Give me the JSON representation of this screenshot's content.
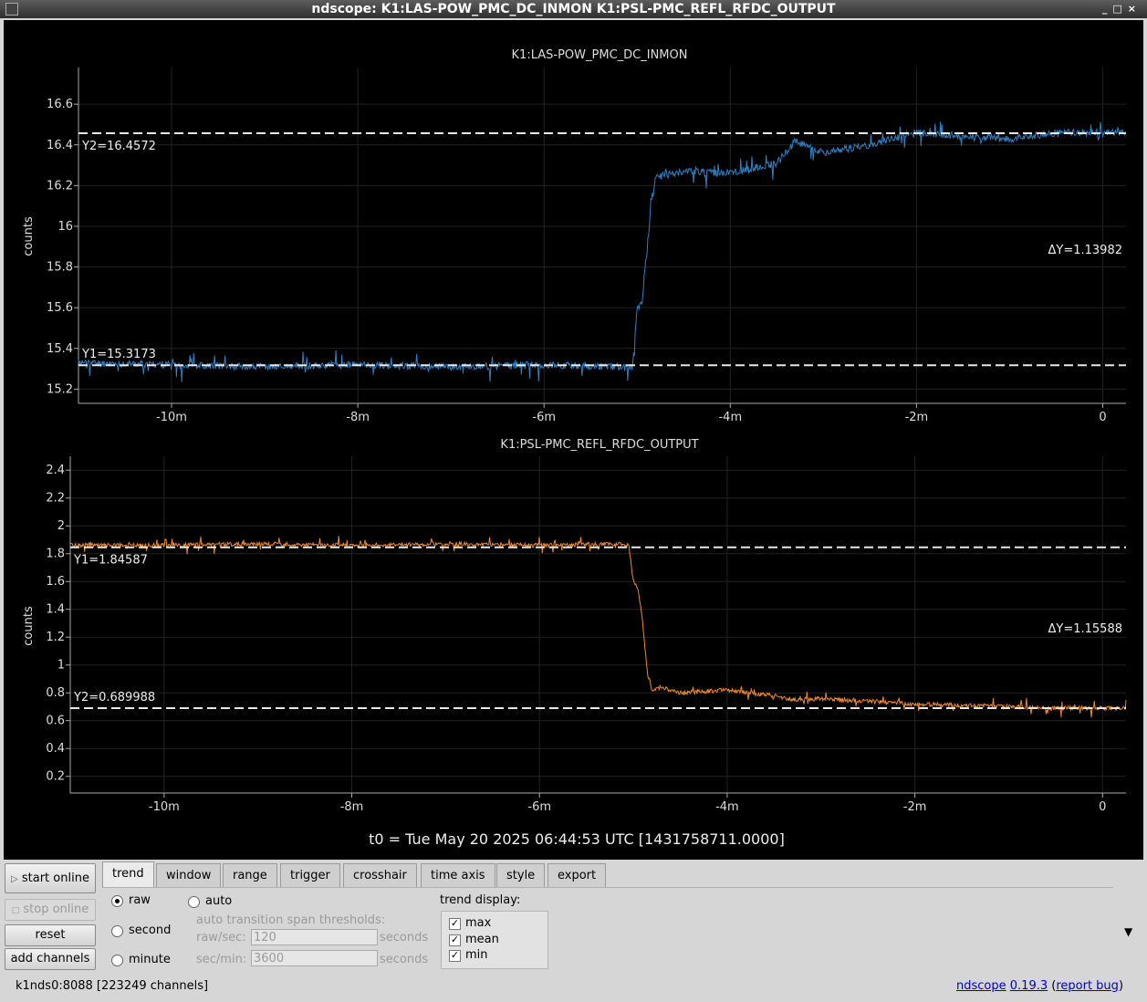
{
  "window": {
    "title": "ndscope: K1:LAS-POW_PMC_DC_INMON K1:PSL-PMC_REFL_RFDC_OUTPUT"
  },
  "plots": [
    {
      "title": "K1:LAS-POW_PMC_DC_INMON",
      "ylabel": "counts",
      "yticks": [
        "16.6",
        "16.4",
        "16.2",
        "16",
        "15.8",
        "15.6",
        "15.4",
        "15.2"
      ],
      "xticks": [
        "-10m",
        "-8m",
        "-6m",
        "-4m",
        "-2m",
        "0"
      ],
      "cursor_y1": "Y1=15.3173",
      "cursor_y2": "Y2=16.4572",
      "cursor_dy": "ΔY=1.13982",
      "color": "#2f7fc1"
    },
    {
      "title": "K1:PSL-PMC_REFL_RFDC_OUTPUT",
      "ylabel": "counts",
      "yticks": [
        "2.4",
        "2.2",
        "2",
        "1.8",
        "1.6",
        "1.4",
        "1.2",
        "1",
        "0.8",
        "0.6",
        "0.4",
        "0.2"
      ],
      "xticks": [
        "-10m",
        "-8m",
        "-6m",
        "-4m",
        "-2m",
        "0"
      ],
      "cursor_y1": "Y1=1.84587",
      "cursor_y2": "Y2=0.689988",
      "cursor_dy": "ΔY=1.15588",
      "color": "#f08a2c"
    }
  ],
  "chart_data": [
    {
      "type": "line",
      "title": "K1:LAS-POW_PMC_DC_INMON",
      "ylabel": "counts",
      "x_unit": "minutes",
      "xlim": [
        -11.0,
        0.25
      ],
      "ylim": [
        15.13,
        16.78
      ],
      "grid": true,
      "series": [
        {
          "x": [
            -11.0,
            -10.0,
            -9.0,
            -8.0,
            -7.0,
            -6.0,
            -5.2,
            -5.05,
            -5.0,
            -4.95,
            -4.9,
            -4.85,
            -4.8,
            -4.7,
            -4.5,
            -4.0,
            -3.5,
            -3.3,
            -3.0,
            -2.5,
            -2.0,
            -1.5,
            -1.0,
            -0.5,
            0.0,
            0.25
          ],
          "y": [
            15.33,
            15.32,
            15.31,
            15.32,
            15.31,
            15.32,
            15.31,
            15.3,
            15.6,
            15.62,
            15.85,
            16.1,
            16.24,
            16.25,
            16.27,
            16.26,
            16.31,
            16.42,
            16.36,
            16.4,
            16.46,
            16.44,
            16.43,
            16.46,
            16.46,
            16.46
          ]
        }
      ]
    },
    {
      "type": "line",
      "title": "K1:PSL-PMC_REFL_RFDC_OUTPUT",
      "ylabel": "counts",
      "x_unit": "minutes",
      "xlim": [
        -11.0,
        0.25
      ],
      "ylim": [
        0.08,
        2.5
      ],
      "grid": true,
      "series": [
        {
          "x": [
            -11.0,
            -10.0,
            -9.0,
            -8.0,
            -7.0,
            -6.0,
            -5.2,
            -5.05,
            -5.0,
            -4.95,
            -4.9,
            -4.85,
            -4.8,
            -4.7,
            -4.5,
            -4.0,
            -3.5,
            -3.3,
            -3.0,
            -2.5,
            -2.0,
            -1.5,
            -1.0,
            -0.5,
            0.0,
            0.25
          ],
          "y": [
            1.86,
            1.86,
            1.87,
            1.86,
            1.87,
            1.86,
            1.87,
            1.86,
            1.6,
            1.55,
            1.3,
            0.95,
            0.82,
            0.84,
            0.8,
            0.82,
            0.78,
            0.75,
            0.76,
            0.74,
            0.72,
            0.71,
            0.7,
            0.69,
            0.69,
            0.69
          ]
        }
      ]
    }
  ],
  "timestamp": "t0 = Tue May 20 2025 06:44:53 UTC [1431758711.0000]",
  "controls": {
    "start_online": "start online",
    "stop_online": "stop online",
    "reset": "reset",
    "add_channels": "add channels",
    "tabs": [
      "trend",
      "window",
      "range",
      "trigger",
      "crosshair",
      "time axis",
      "style",
      "export"
    ],
    "radio_raw": "raw",
    "radio_second": "second",
    "radio_minute": "minute",
    "radio_auto": "auto",
    "auto_title": "auto transition span thresholds:",
    "raw_sec_label": "raw/sec:",
    "raw_sec_value": "120",
    "sec_min_label": "sec/min:",
    "sec_min_value": "3600",
    "seconds": "seconds",
    "trend_display": "trend display:",
    "check_max": "max",
    "check_mean": "mean",
    "check_min": "min"
  },
  "status": {
    "server": "k1nds0:8088  [223249 channels]",
    "app_link": "ndscope",
    "version_link": "0.19.3",
    "report_link": "report bug"
  }
}
